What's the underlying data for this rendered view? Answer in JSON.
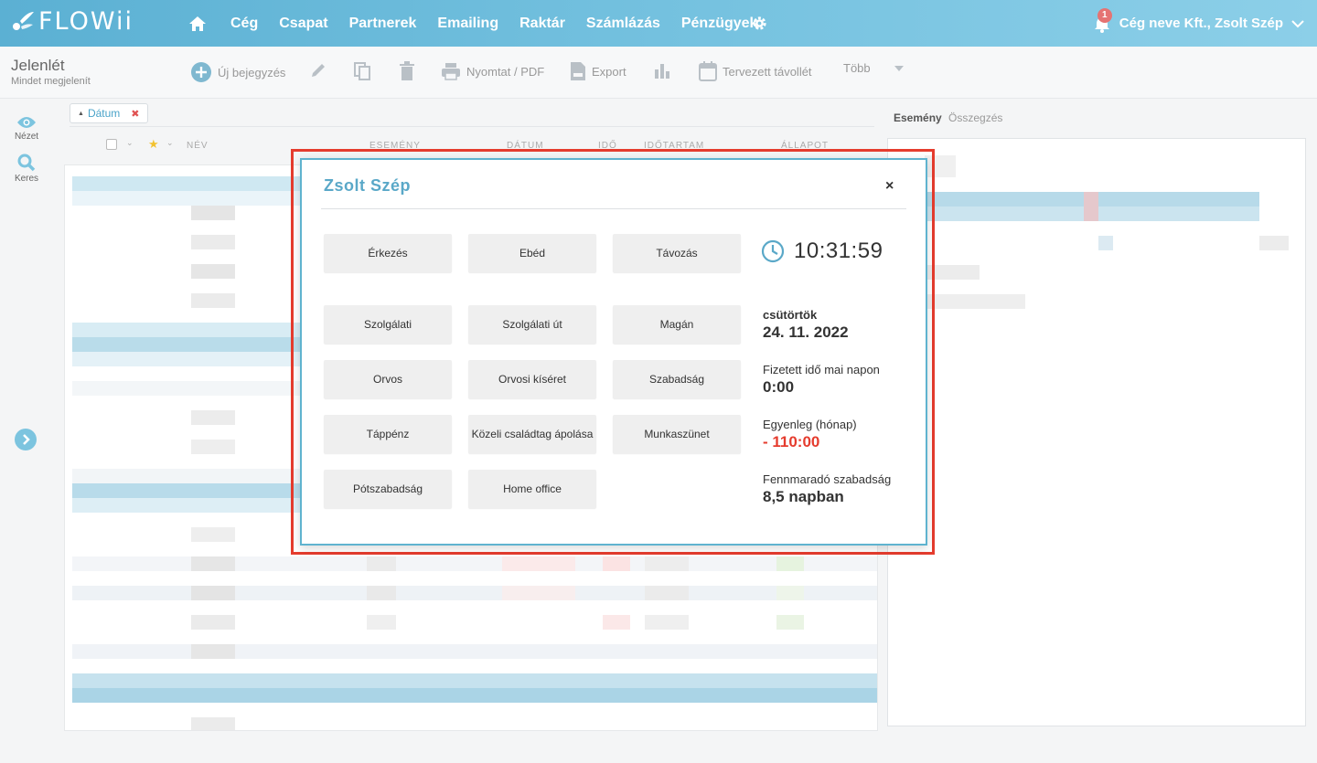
{
  "app": {
    "logo_text": "FLOWii",
    "nav_items": [
      "Cég",
      "Csapat",
      "Partnerek",
      "Emailing",
      "Raktár",
      "Számlázás",
      "Pénzügyek"
    ],
    "notification_count": "1",
    "user_label": "Cég neve Kft., Zsolt Szép",
    "colors": {
      "accent": "#5bb0d3",
      "danger": "#e53c2e"
    }
  },
  "page": {
    "title": "Jelenlét",
    "subtitle": "Mindet megjelenít"
  },
  "toolbar": {
    "new_entry": "Új bejegyzés",
    "print": "Nyomtat / PDF",
    "export": "Export",
    "planned_absence": "Tervezett távollét",
    "more": "Több"
  },
  "sidebar": {
    "view": "Nézet",
    "search": "Keres"
  },
  "filter": {
    "chip_label": "Dátum"
  },
  "table": {
    "headers": [
      "NÉV",
      "ESEMÉNY",
      "DÁTUM",
      "IDŐ",
      "IDŐTARTAM",
      "ÁLLAPOT"
    ]
  },
  "right_panel": {
    "tab_active": "Esemény",
    "tab_inactive": "Összegzés"
  },
  "modal": {
    "title": "Zsolt Szép",
    "close": "×",
    "buttons": [
      "Érkezés",
      "Ebéd",
      "Távozás",
      "Szolgálati",
      "Szolgálati út",
      "Magán",
      "Orvos",
      "Orvosi kíséret",
      "Szabadság",
      "Táppénz",
      "Közeli családtag ápolása",
      "Munkaszünet",
      "Pótszabadság",
      "Home office"
    ],
    "time": "10:31:59",
    "weekday": "csütörtök",
    "date": "24. 11. 2022",
    "paid_time_label": "Fizetett idő mai napon",
    "paid_time_value": "0:00",
    "balance_label": "Egyenleg (hónap)",
    "balance_value": "- 110:00",
    "remaining_leave_label": "Fennmaradó szabadság",
    "remaining_leave_value": "8,5 napban"
  }
}
